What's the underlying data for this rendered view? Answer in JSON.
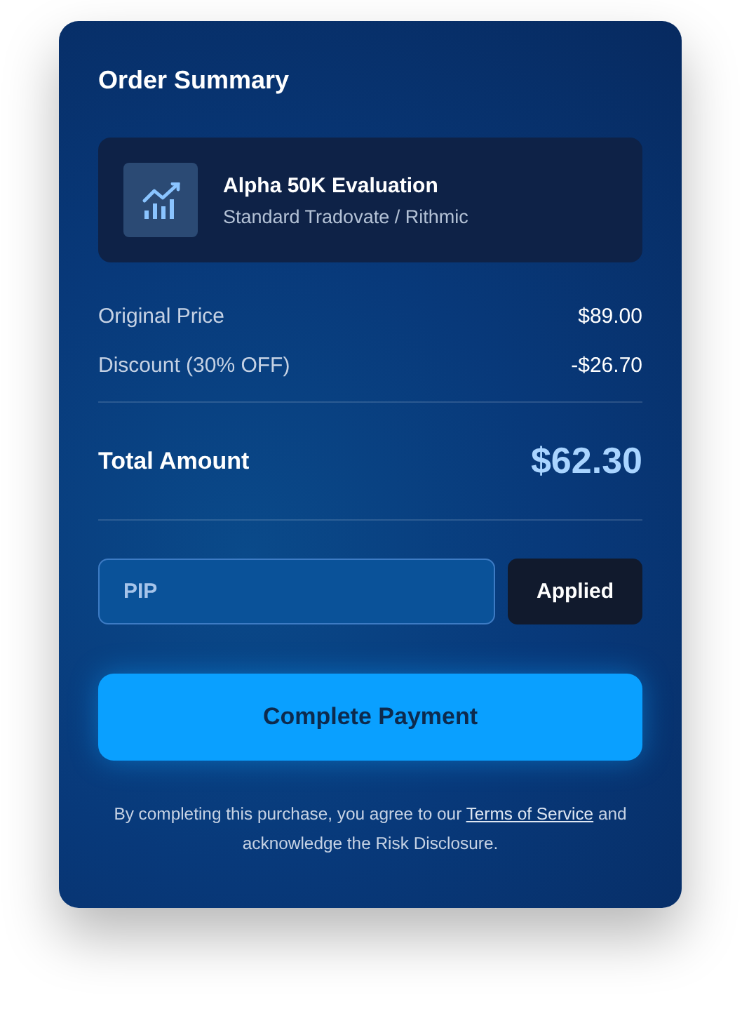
{
  "title": "Order Summary",
  "product": {
    "name": "Alpha 50K Evaluation",
    "subtitle": "Standard Tradovate / Rithmic"
  },
  "price_lines": [
    {
      "label": "Original Price",
      "value": "$89.00"
    },
    {
      "label": "Discount (30% OFF)",
      "value": "-$26.70"
    }
  ],
  "total": {
    "label": "Total Amount",
    "value": "$62.30"
  },
  "promo": {
    "value": "PIP",
    "button": "Applied"
  },
  "pay_button": "Complete Payment",
  "disclaimer": {
    "before": "By completing this purchase, you agree to our ",
    "link": "Terms of Service",
    "after": " and acknowledge the Risk Disclosure."
  }
}
